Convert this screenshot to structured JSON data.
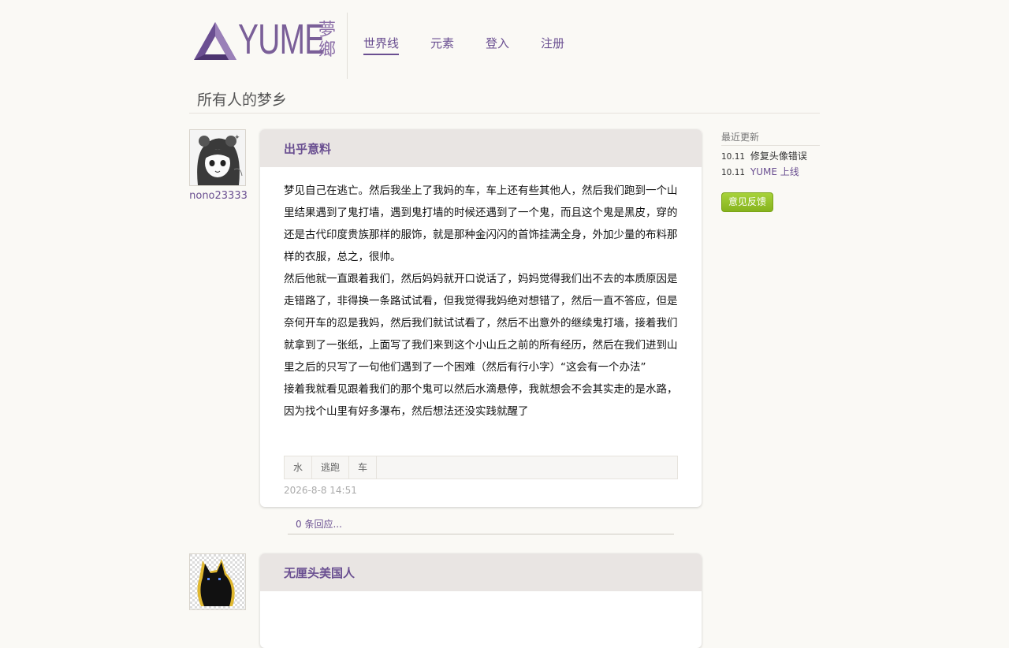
{
  "header": {
    "logo_text": "YUME",
    "logo_cn": "夢鄉",
    "nav": [
      {
        "label": "世界线",
        "active": true
      },
      {
        "label": "元素",
        "active": false
      },
      {
        "label": "登入",
        "active": false
      },
      {
        "label": "注册",
        "active": false
      }
    ],
    "site_title": "所有人的梦乡"
  },
  "posts": [
    {
      "username": "nono23333",
      "title": "出乎意料",
      "paragraphs": [
        "梦见自己在逃亡。然后我坐上了我妈的车，车上还有些其他人，然后我们跑到一个山里结果遇到了鬼打墙，遇到鬼打墙的时候还遇到了一个鬼，而且这个鬼是黑皮，穿的还是古代印度贵族那样的服饰，就是那种金闪闪的首饰挂满全身，外加少量的布料那样的衣服，总之，很帅。",
        "然后他就一直跟着我们，然后妈妈就开口说话了，妈妈觉得我们出不去的本质原因是走错路了，非得换一条路试试看，但我觉得我妈绝对想错了，然后一直不答应，但是奈何开车的忍是我妈，然后我们就试试看了，然后不出意外的继续鬼打墙，接着我们就拿到了一张纸，上面写了我们来到这个小山丘之前的所有经历，然后在我们进到山里之后的只写了一句他们遇到了一个困难（然后有行小字）“这会有一个办法”",
        "接着我就看见跟着我们的那个鬼可以然后水滴悬停，我就想会不会其实走的是水路，因为找个山里有好多瀑布，然后想法还没实践就醒了"
      ],
      "tags": [
        "水",
        "逃跑",
        "车"
      ],
      "date": "2026-8-8 14:51",
      "replies": "0 条回应..."
    },
    {
      "title": "无厘头美国人"
    }
  ],
  "sidebar": {
    "heading": "最近更新",
    "updates": [
      {
        "date": "10.11",
        "text": "修复头像错误"
      },
      {
        "date": "10.11",
        "text": "YUME 上线"
      }
    ],
    "feedback_label": "意见反馈"
  },
  "colors": {
    "accent": "#6a4f91",
    "background": "#faf9f5",
    "post_header": "#e9e5e3",
    "feedback_button": "#93c128"
  }
}
